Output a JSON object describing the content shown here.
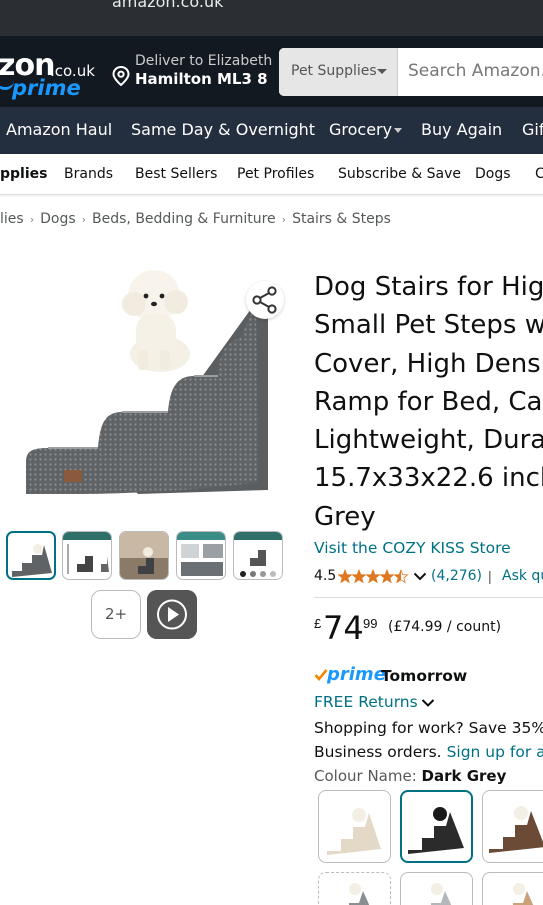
{
  "browser": {
    "url": "amazon.co.uk"
  },
  "header": {
    "logo_main": "zon",
    "logo_domain": ".co.uk",
    "logo_prime": "prime",
    "deliver_line1": "Deliver to Elizabeth",
    "deliver_line2": "Hamilton ML3 8",
    "search_department": "Pet Supplies",
    "search_placeholder": "Search Amazon.c"
  },
  "nav_main": {
    "items": [
      "Amazon Haul",
      "Same Day & Overnight",
      "Grocery",
      "Buy Again",
      "Gif"
    ]
  },
  "subnav": {
    "items": [
      "pplies",
      "Brands",
      "Best Sellers",
      "Pet Profiles",
      "Subscribe & Save",
      "Dogs",
      "C"
    ]
  },
  "breadcrumb": [
    "lies",
    "Dogs",
    "Beds, Bedding & Furniture",
    "Stairs & Steps"
  ],
  "gallery": {
    "more_label": "2+",
    "thumbnails": [
      "main",
      "dimensions",
      "lifestyle",
      "features",
      "variants"
    ]
  },
  "product": {
    "title_lines": [
      "Dog Stairs for Hig",
      "Small Pet Steps w",
      "Cover, High Densi",
      "Ramp for Bed, Car",
      "Lightweight, Dura",
      "15.7x33x22.6 inch",
      "Grey"
    ],
    "store_link": "Visit the COZY KISS Store",
    "rating_value": "4.5",
    "rating_stars": 4.5,
    "rating_count": "(4,276)",
    "rating_separator": "|",
    "ask_link": "Ask qu",
    "price_currency": "£",
    "price_whole": "74",
    "price_fraction": "99",
    "price_per_unit": "(£74.99 / count)",
    "prime_label": "prime",
    "delivery_day": "Tomorrow",
    "returns_label": "FREE Returns",
    "business_line1": "Shopping for work? Save 35%",
    "business_line2_text": "Business orders.",
    "business_line2_link": "Sign up for a f",
    "colour_label": "Colour Name:",
    "colour_value": "Dark Grey"
  },
  "colors": {
    "header_bg": "#131921",
    "nav_bg": "#232f3e",
    "link": "#007185",
    "prime_blue": "#1a98ff",
    "star": "#de7921"
  }
}
